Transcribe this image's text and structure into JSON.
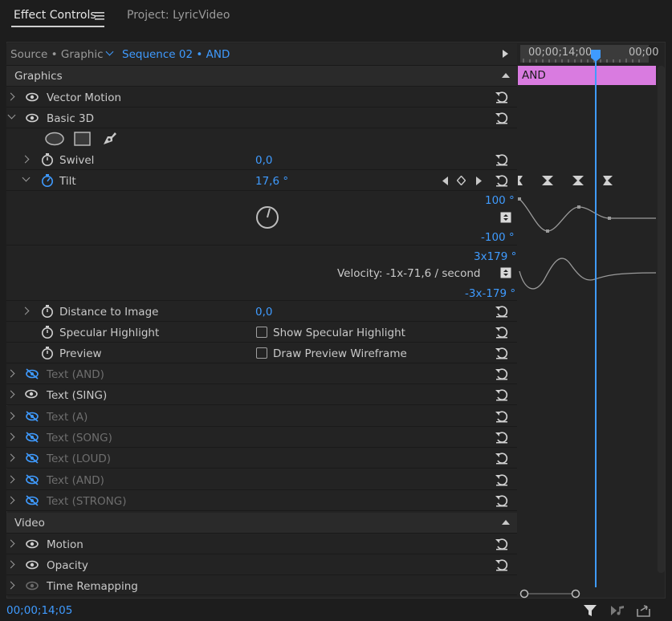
{
  "tabs": {
    "effect_controls": "Effect Controls",
    "project": "Project: LyricVideo"
  },
  "source_bar": {
    "source": "Source • Graphic",
    "sequence": "Sequence 02 • AND"
  },
  "timeline": {
    "time_start": "00;00;14;00",
    "time_end": "00;00",
    "clip_label": "AND",
    "clip_color": "#d97be0",
    "playhead_color": "#3f9bff"
  },
  "graphics": {
    "header": "Graphics",
    "vector_motion": "Vector Motion",
    "basic3d": "Basic 3D",
    "swivel": {
      "label": "Swivel",
      "value": "0,0"
    },
    "tilt": {
      "label": "Tilt",
      "value": "17,6 °"
    },
    "graph1": {
      "max": "100 °",
      "min": "-100 °"
    },
    "graph2": {
      "max": "3x179 °",
      "min": "-3x-179 °",
      "velocity": "Velocity: -1x-71,6 / second"
    },
    "distance": {
      "label": "Distance to Image",
      "value": "0,0"
    },
    "specular": {
      "label": "Specular Highlight",
      "checkbox": "Show Specular Highlight"
    },
    "preview": {
      "label": "Preview",
      "checkbox": "Draw Preview Wireframe"
    },
    "layers": [
      {
        "label": "Text (AND)",
        "visible": false
      },
      {
        "label": "Text (SING)",
        "visible": true
      },
      {
        "label": "Text (A)",
        "visible": false
      },
      {
        "label": "Text (SONG)",
        "visible": false
      },
      {
        "label": "Text (LOUD)",
        "visible": false
      },
      {
        "label": "Text (AND)",
        "visible": false
      },
      {
        "label": "Text (STRONG)",
        "visible": false
      }
    ]
  },
  "video": {
    "header": "Video",
    "motion": "Motion",
    "opacity": "Opacity",
    "time_remap": "Time Remapping"
  },
  "footer": {
    "timecode": "00;00;14;05"
  }
}
